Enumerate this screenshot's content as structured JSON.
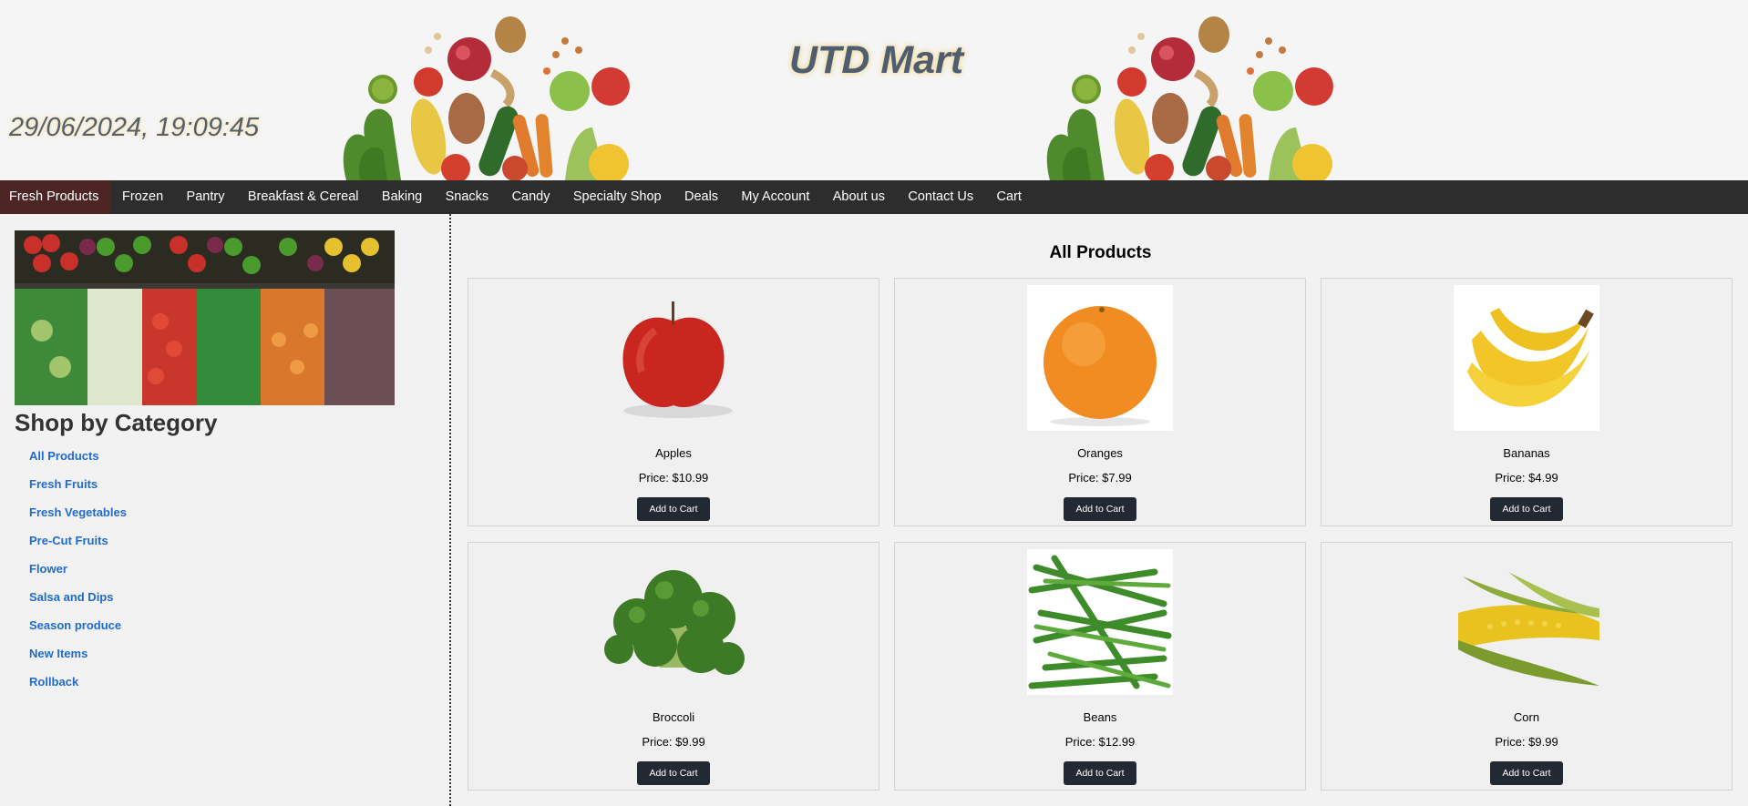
{
  "header": {
    "datetime": "29/06/2024, 19:09:45",
    "brand": "UTD Mart"
  },
  "nav": {
    "items": [
      "Fresh Products",
      "Frozen",
      "Pantry",
      "Breakfast & Cereal",
      "Baking",
      "Snacks",
      "Candy",
      "Specialty Shop",
      "Deals",
      "My Account",
      "About us",
      "Contact Us",
      "Cart"
    ],
    "active": "Fresh Products"
  },
  "sidebar": {
    "title": "Shop by Category",
    "categories": [
      "All Products",
      "Fresh Fruits",
      "Fresh Vegetables",
      "Pre-Cut Fruits",
      "Flower",
      "Salsa and Dips",
      "Season produce",
      "New Items",
      "Rollback"
    ]
  },
  "main": {
    "title": "All Products",
    "add_label": "Add to Cart",
    "products": [
      {
        "name": "Apples",
        "price": "Price: $10.99",
        "icon": "apple-image"
      },
      {
        "name": "Oranges",
        "price": "Price: $7.99",
        "icon": "orange-image"
      },
      {
        "name": "Bananas",
        "price": "Price: $4.99",
        "icon": "banana-image"
      },
      {
        "name": "Broccoli",
        "price": "Price: $9.99",
        "icon": "broccoli-image"
      },
      {
        "name": "Beans",
        "price": "Price: $12.99",
        "icon": "beans-image"
      },
      {
        "name": "Corn",
        "price": "Price: $9.99",
        "icon": "corn-image"
      }
    ]
  },
  "colors": {
    "nav_bg": "#2d2d2d",
    "nav_active": "#4e2525",
    "link": "#1f6bd0",
    "button": "#222933"
  }
}
